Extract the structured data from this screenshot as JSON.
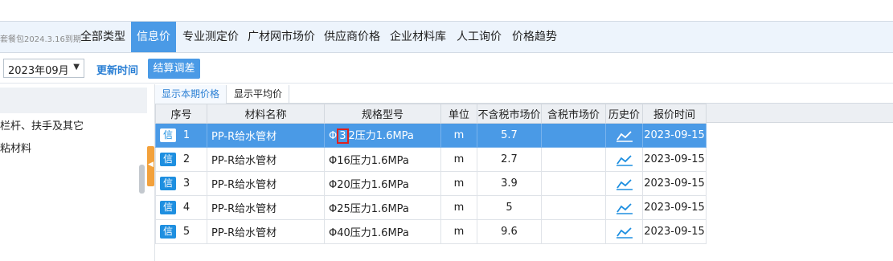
{
  "header": {
    "package_text": "套餐包2024.3.16到期",
    "tabs": [
      {
        "label": "全部类型",
        "active": false
      },
      {
        "label": "信息价",
        "active": true
      },
      {
        "label": "专业测定价",
        "active": false
      },
      {
        "label": "广材网市场价",
        "active": false
      },
      {
        "label": "供应商价格",
        "active": false
      },
      {
        "label": "企业材料库",
        "active": false
      },
      {
        "label": "人工询价",
        "active": false
      },
      {
        "label": "价格趋势",
        "active": false
      }
    ]
  },
  "toolbar": {
    "period_value": "2023年09月",
    "update_time_label": "更新时间",
    "settle_button_label": "结算调差"
  },
  "tree": {
    "items": [
      "栏杆、扶手及其它",
      "粘材料"
    ]
  },
  "subtabs": [
    "显示本期价格",
    "显示平均价"
  ],
  "table": {
    "columns": [
      "序号",
      "材料名称",
      "规格型号",
      "单位",
      "不含税市场价",
      "含税市场价",
      "历史价",
      "报价时间"
    ],
    "badge_label": "信",
    "rows": [
      {
        "seq": "1",
        "name": "PP-R给水管材",
        "spec_prefix": "Φ",
        "spec_boxed": "3",
        "spec_rest": "2压力1.6MPa",
        "spec": "",
        "unit": "m",
        "price_ex": "5.7",
        "price_inc": "",
        "date": "2023-09-15",
        "selected": true
      },
      {
        "seq": "2",
        "name": "PP-R给水管材",
        "spec": "Φ16压力1.6MPa",
        "unit": "m",
        "price_ex": "2.7",
        "price_inc": "",
        "date": "2023-09-15"
      },
      {
        "seq": "3",
        "name": "PP-R给水管材",
        "spec": "Φ20压力1.6MPa",
        "unit": "m",
        "price_ex": "3.9",
        "price_inc": "",
        "date": "2023-09-15"
      },
      {
        "seq": "4",
        "name": "PP-R给水管材",
        "spec": "Φ25压力1.6MPa",
        "unit": "m",
        "price_ex": "5",
        "price_inc": "",
        "date": "2023-09-15"
      },
      {
        "seq": "5",
        "name": "PP-R给水管材",
        "spec": "Φ40压力1.6MPa",
        "unit": "m",
        "price_ex": "9.6",
        "price_inc": "",
        "date": "2023-09-15"
      }
    ]
  },
  "colors": {
    "accent": "#4a9ae6",
    "badge": "#1e8fe0",
    "highlight_box": "#e0211d",
    "splitter": "#f3a13b"
  },
  "icons": {
    "history": "trend-line-icon",
    "splitter": "collapse-left-icon",
    "select_caret": "caret-down-icon"
  }
}
